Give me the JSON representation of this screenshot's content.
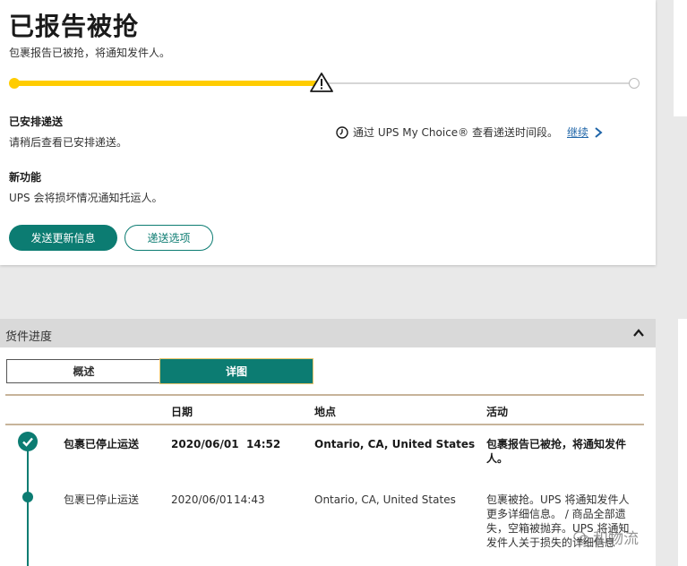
{
  "status": {
    "title": "已报告被抢",
    "subtitle": "包裹报告已被抢，将通知发件人。"
  },
  "scheduled": {
    "heading": "已安排递送",
    "text": "请稍后查看已安排递送。"
  },
  "my_choice": {
    "text": "通过 UPS My Choice® 查看递送时间段。",
    "link": "继续"
  },
  "new_feature": {
    "heading": "新功能",
    "text": "UPS 会将损坏情况通知托运人。"
  },
  "buttons": {
    "send_updates": "发送更新信息",
    "delivery_options": "递送选项"
  },
  "progress_section": {
    "title": "货件进度",
    "tabs": [
      "概述",
      "详图"
    ],
    "active_tab": "详图",
    "columns": [
      "日期",
      "地点",
      "活动"
    ],
    "rows": [
      {
        "status": "包裹已停止运送",
        "date": "2020/06/01",
        "time": "14:52",
        "location": "Ontario, CA, United States",
        "activity": "包裹报告已被抢，将通知发件人。"
      },
      {
        "status": "包裹已停止运送",
        "date": "2020/06/01",
        "time": "14:43",
        "location": "Ontario, CA, United States",
        "activity": "包裹被抢。UPS 将通知发件人更多详细信息。 / 商品全部遗失，空箱被抛弃。UPS 将通知发件人关于损失的详细信息"
      }
    ]
  },
  "watermark": "和物流",
  "colors": {
    "accent": "#0c7c72",
    "progress": "#ffcc00",
    "link": "#1f65a8"
  },
  "icons": [
    "warning-icon",
    "clock-icon",
    "chevron-right-icon",
    "chevron-up-icon",
    "check-icon"
  ]
}
